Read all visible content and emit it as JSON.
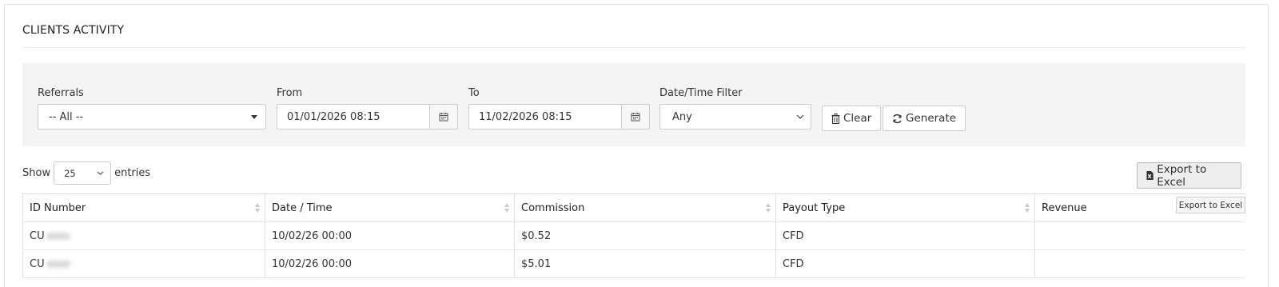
{
  "title": "CLIENTS ACTIVITY",
  "filters": {
    "referrals": {
      "label": "Referrals",
      "value": "-- All --"
    },
    "from": {
      "label": "From",
      "value": "01/01/2026 08:15"
    },
    "to": {
      "label": "To",
      "value": "11/02/2026 08:15"
    },
    "datetime_filter": {
      "label": "Date/Time Filter",
      "value": "Any"
    },
    "clear_label": "Clear",
    "generate_label": "Generate"
  },
  "length_menu": {
    "show": "Show",
    "value": "25",
    "entries": "entries"
  },
  "export": {
    "label": "Export to Excel",
    "tooltip": "Export to Excel"
  },
  "table": {
    "columns": [
      "ID Number",
      "Date / Time",
      "Commission",
      "Payout Type",
      "Revenue"
    ],
    "rows": [
      {
        "id": "CU",
        "datetime": "10/02/26 00:00",
        "commission": "$0.52",
        "payout": "CFD",
        "revenue": ""
      },
      {
        "id": "CU",
        "datetime": "10/02/26 00:00",
        "commission": "$5.01",
        "payout": "CFD",
        "revenue": ""
      }
    ]
  },
  "icons": {
    "calendar": "calendar-icon",
    "trash": "trash-icon",
    "refresh": "refresh-icon",
    "excel": "excel-file-icon"
  }
}
